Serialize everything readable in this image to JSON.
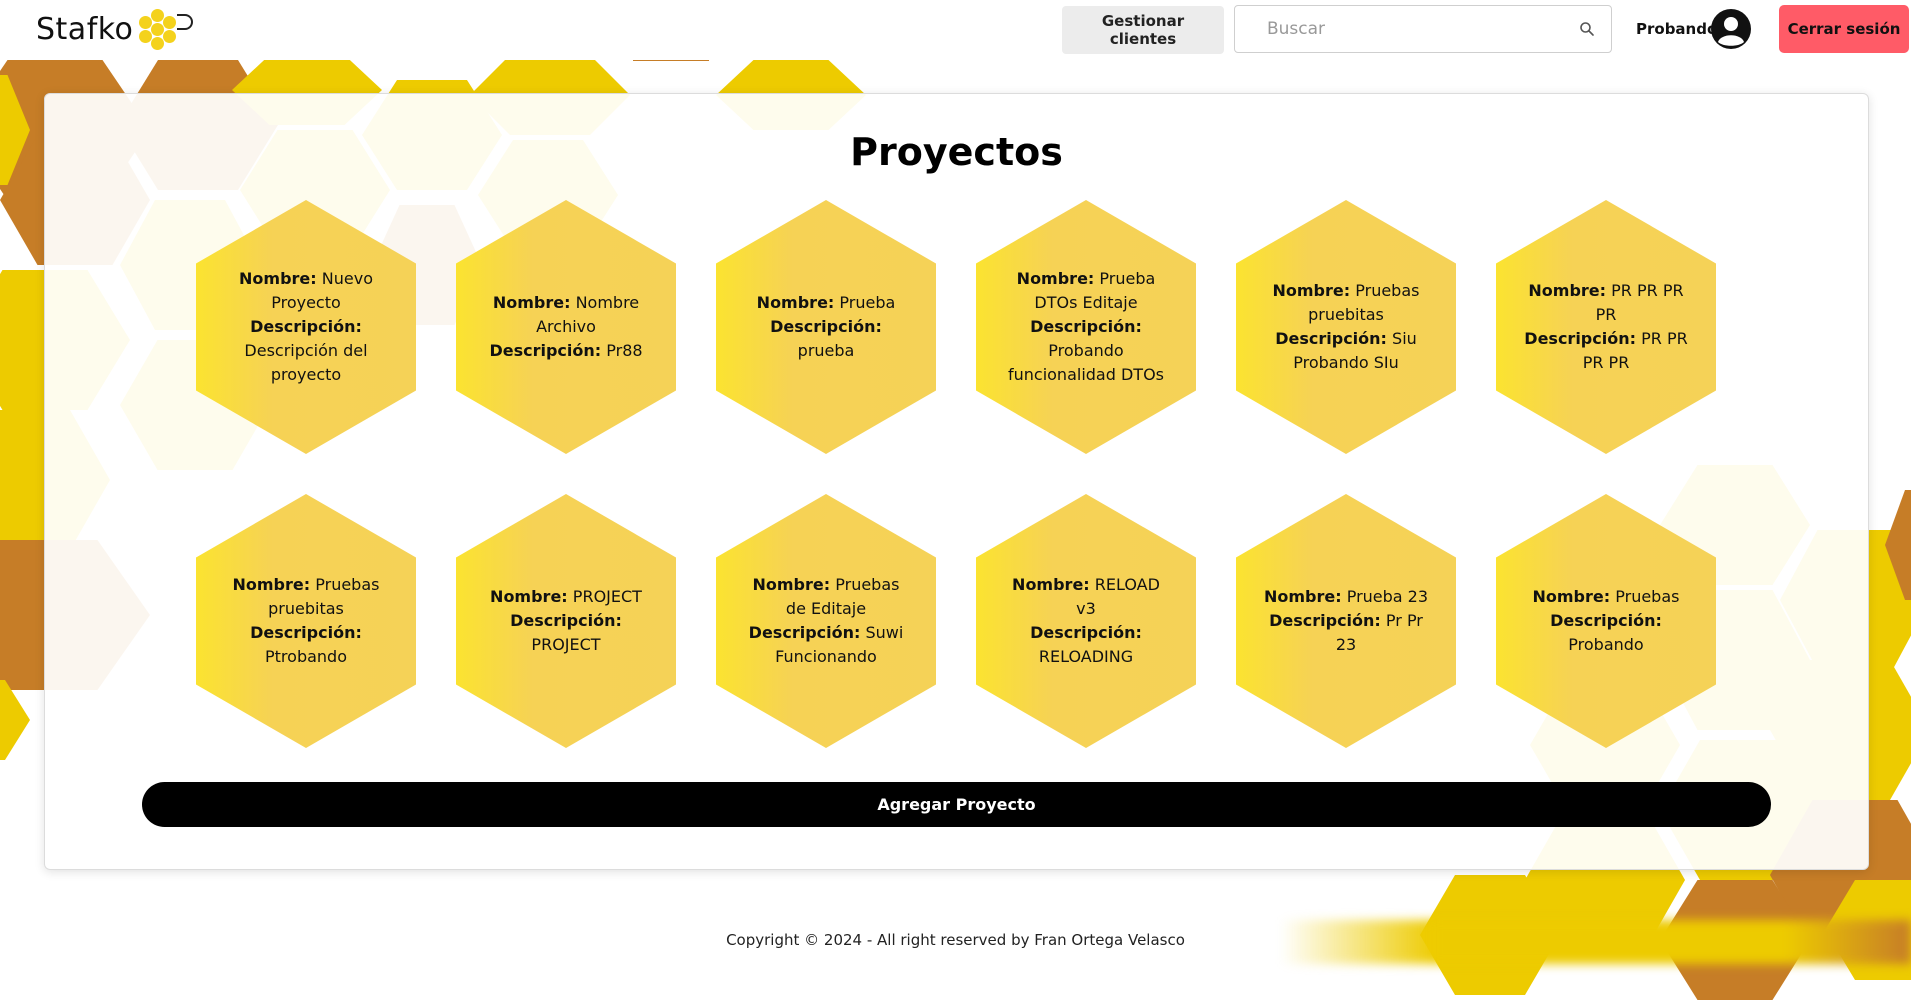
{
  "header": {
    "logo_text": "Stafko",
    "manage_clients_label": "Gestionar clientes",
    "search_placeholder": "Buscar",
    "search_value": "",
    "user_name": "Probando",
    "logout_label": "Cerrar sesión"
  },
  "main": {
    "title": "Proyectos",
    "name_label": "Nombre:",
    "description_label": "Descripción:",
    "projects": [
      {
        "name": "Nuevo Proyecto",
        "description": "Descripción del proyecto"
      },
      {
        "name": "Nombre Archivo",
        "description": "Pr88"
      },
      {
        "name": "Prueba",
        "description": "prueba"
      },
      {
        "name": "Prueba DTOs Editaje",
        "description": "Probando funcionalidad DTOs"
      },
      {
        "name": "Pruebas pruebitas",
        "description": "Siu Probando SIu"
      },
      {
        "name": "PR PR PR PR",
        "description": "PR PR PR PR"
      },
      {
        "name": "Pruebas pruebitas",
        "description": "Ptrobando"
      },
      {
        "name": "PROJECT",
        "description": "PROJECT"
      },
      {
        "name": "Pruebas de Editaje",
        "description": "Suwi Funcionando"
      },
      {
        "name": "RELOAD v3",
        "description": "RELOADING"
      },
      {
        "name": "Prueba 23",
        "description": "Pr Pr 23"
      },
      {
        "name": "Pruebas",
        "description": "Probando"
      }
    ],
    "add_project_label": "Agregar Proyecto"
  },
  "footer": {
    "copyright": "Copyright © 2024 - All right reserved by Fran Ortega Velasco"
  },
  "colors": {
    "accent_yellow": "#f5d257",
    "honey_dark": "#c67d27",
    "honey_yellow": "#edcb00",
    "logout_red": "#ff5b67",
    "add_button": "#000000"
  }
}
